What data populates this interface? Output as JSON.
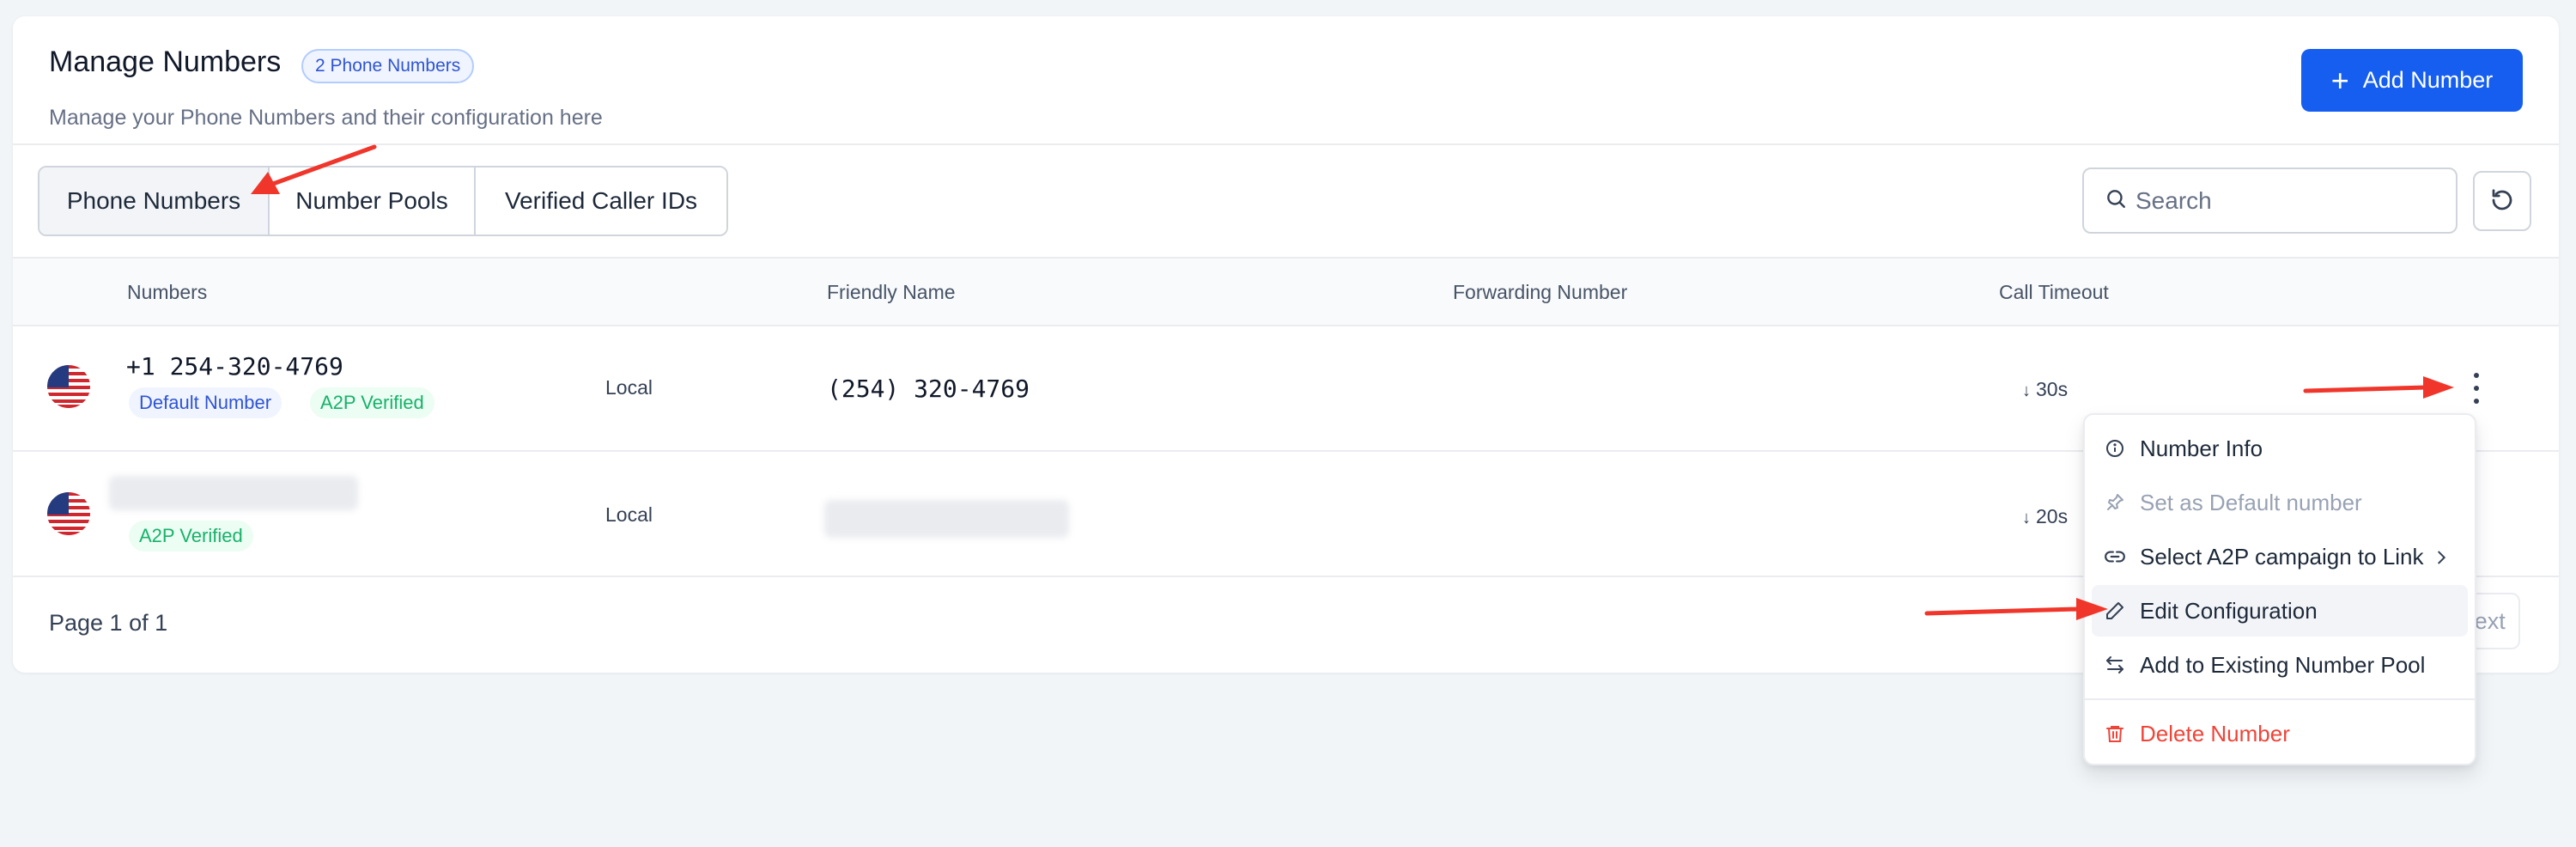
{
  "header": {
    "title": "Manage Numbers",
    "count_badge": "2 Phone Numbers",
    "subtitle": "Manage your Phone Numbers and their configuration here",
    "add_button": "Add Number"
  },
  "tabs": [
    {
      "label": "Phone Numbers",
      "active": true
    },
    {
      "label": "Number Pools",
      "active": false
    },
    {
      "label": "Verified Caller IDs",
      "active": false
    }
  ],
  "search": {
    "placeholder": "Search"
  },
  "table": {
    "columns": [
      "Numbers",
      "Friendly Name",
      "Forwarding Number",
      "Call Timeout"
    ],
    "rows": [
      {
        "number": "+1 254-320-4769",
        "badges": [
          "Default Number",
          "A2P Verified"
        ],
        "type": "Local",
        "friendly_name": "(254) 320-4769",
        "forwarding_number": "",
        "call_timeout": "30s"
      },
      {
        "number": "",
        "badges": [
          "A2P Verified"
        ],
        "type": "Local",
        "friendly_name": "",
        "forwarding_number": "",
        "call_timeout": "20s"
      }
    ]
  },
  "pagination": {
    "page_info": "Page 1 of 1",
    "next_label": "Next"
  },
  "menu": {
    "items": [
      {
        "label": "Number Info",
        "icon": "info-icon"
      },
      {
        "label": "Set as Default number",
        "icon": "pin-icon",
        "disabled": true
      },
      {
        "label": "Select A2P campaign to Link",
        "icon": "link-icon",
        "has_submenu": true
      },
      {
        "label": "Edit Configuration",
        "icon": "pencil-icon",
        "highlighted": true
      },
      {
        "label": "Add to Existing Number Pool",
        "icon": "swap-icon"
      },
      {
        "label": "Delete Number",
        "icon": "trash-icon",
        "danger": true
      }
    ]
  },
  "colors": {
    "primary": "#155eef",
    "annotation_arrow": "#f0362b",
    "success": "#17b26a",
    "danger": "#f04438"
  }
}
